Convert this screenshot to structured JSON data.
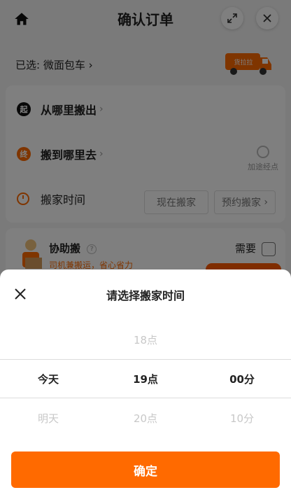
{
  "header": {
    "title": "确认订单"
  },
  "vehicle": {
    "selected_label": "已选: 微面包车",
    "van_text": "货拉拉"
  },
  "address": {
    "from_badge": "起",
    "from": "从哪里搬出",
    "to_badge": "终",
    "to": "搬到哪里去",
    "via": "加途经点"
  },
  "moving_time": {
    "label": "搬家时间",
    "now": "现在搬家",
    "book": "预约搬家"
  },
  "helper": {
    "title": "协助搬",
    "help_mark": "?",
    "subtitle": "司机兼搬运，省心省力",
    "need_label": "需要"
  },
  "sheet": {
    "title": "请选择搬家时间",
    "columns": {
      "day": {
        "above": "",
        "selected": "今天",
        "below": "明天"
      },
      "hour": {
        "above": "18点",
        "selected": "19点",
        "below": "20点"
      },
      "minute": {
        "above": "",
        "selected": "00分",
        "below": "10分"
      }
    },
    "confirm": "确定"
  },
  "colors": {
    "accent": "#ff6a00",
    "text": "#222222",
    "muted": "#c8c8c8"
  },
  "icons": [
    "home-icon",
    "expand-icon",
    "close-icon",
    "van-icon",
    "clock-icon",
    "via-point-icon",
    "help-icon"
  ]
}
